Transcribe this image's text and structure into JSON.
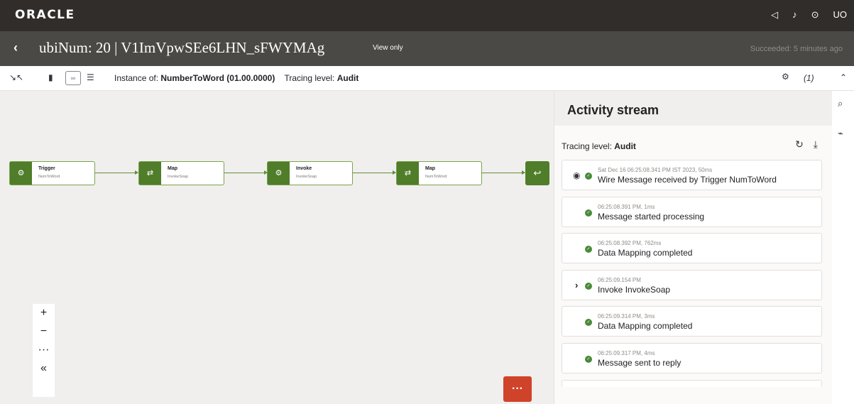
{
  "topbar": {
    "logo": "ORACLE",
    "icons": [
      "announcement-icon",
      "bell-icon",
      "help-icon"
    ],
    "user_initials": "UO"
  },
  "titlebar": {
    "title": "ubiNum: 20 | V1ImVpwSEe6LHN_sFWYMAg",
    "view_only": "View only",
    "status": "Succeeded: 5 minutes ago"
  },
  "toolbar": {
    "instance_label": "Instance of:",
    "instance_value": "NumberToWord (01.00.0000)",
    "tracing_label": "Tracing level:",
    "tracing_value": "Audit",
    "errors_count": "(1)"
  },
  "flow": {
    "nodes": [
      {
        "title": "Trigger",
        "sub": "NumToWord",
        "icon": "trigger-icon"
      },
      {
        "title": "Map",
        "sub": "InvokeSoap",
        "icon": "map-icon"
      },
      {
        "title": "Invoke",
        "sub": "InvokeSoap",
        "icon": "invoke-icon"
      },
      {
        "title": "Map",
        "sub": "NumToWord",
        "icon": "map-icon"
      }
    ],
    "end_icon": "return-icon"
  },
  "zoom": {
    "plus": "+",
    "minus": "−",
    "more": "···",
    "collapse": "«"
  },
  "activity": {
    "title": "Activity stream",
    "tracing_label": "Tracing level:",
    "tracing_value": "Audit",
    "items": [
      {
        "time": "Sat Dec 16 06:25:08.341 PM IST 2023, 50ms",
        "message": "Wire Message received by Trigger NumToWord"
      },
      {
        "time": "06:25:08.391 PM, 1ms",
        "message": "Message started processing"
      },
      {
        "time": "06:25:08.392 PM, 762ms",
        "message": "Data Mapping completed"
      },
      {
        "time": "06:25:09.154 PM",
        "message": "Invoke InvokeSoap"
      },
      {
        "time": "06:25:09.314 PM, 3ms",
        "message": "Data Mapping completed"
      },
      {
        "time": "06:25:09.317 PM, 4ms",
        "message": "Message sent to reply"
      }
    ]
  },
  "colors": {
    "brand_dark": "#312d2a",
    "title_bar": "#4b4945",
    "accent_green": "#4f7d2a",
    "chat": "#d0432b"
  }
}
